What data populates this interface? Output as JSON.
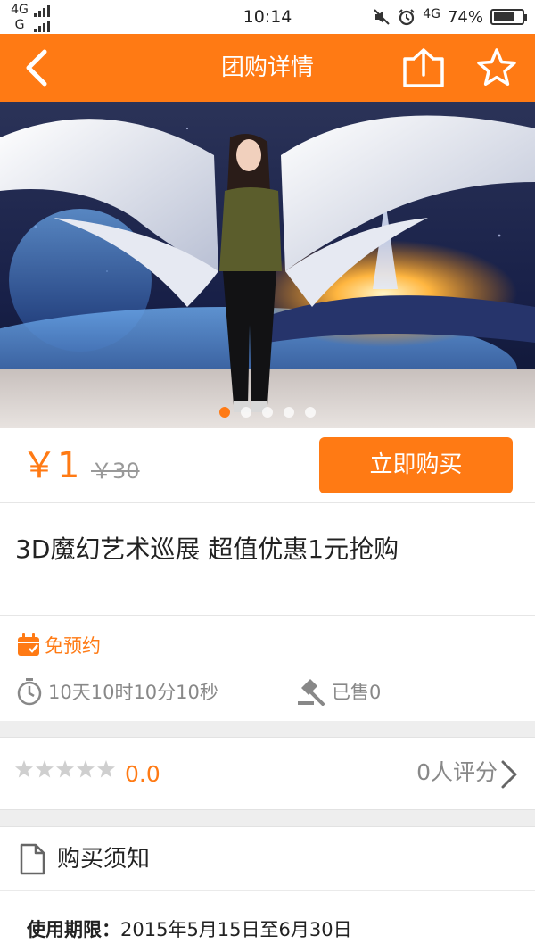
{
  "status_bar": {
    "network_top": "4G",
    "network_bottom": "G",
    "time": "10:14",
    "network_right": "4G",
    "battery_percent": "74%",
    "battery_level": 0.74,
    "icons": [
      "mute-icon",
      "alarm-icon",
      "battery-icon"
    ]
  },
  "nav": {
    "title": "团购详情",
    "icons": [
      "back-icon",
      "share-icon",
      "star-icon"
    ]
  },
  "banner": {
    "slide_count": 5,
    "active_index": 0
  },
  "price": {
    "current": "￥1",
    "original": "￥30",
    "buy_label": "立即购买"
  },
  "deal": {
    "title": "3D魔幻艺术巡展 超值优惠1元抢购"
  },
  "info": {
    "no_reservation": "免预约",
    "countdown": "10天10时10分10秒",
    "sold": "已售0"
  },
  "rating": {
    "stars": 0,
    "score": "0.0",
    "count_label": "0人评分"
  },
  "notice": {
    "title": "购买须知",
    "validity_label": "使用期限：",
    "validity_value": "2015年5月15日至6月30日"
  },
  "colors": {
    "brand": "#ff7a14",
    "muted_text": "#888888"
  }
}
